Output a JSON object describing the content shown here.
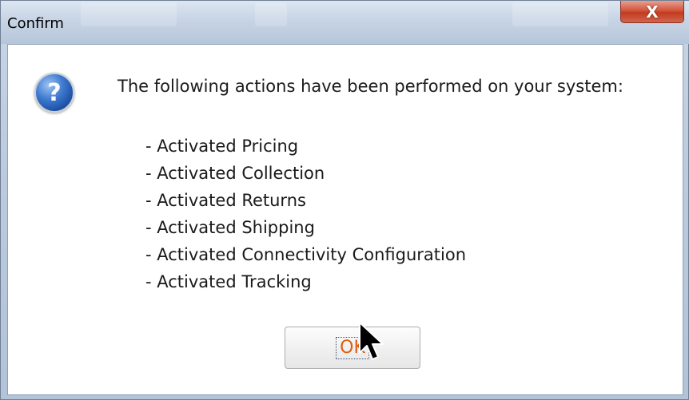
{
  "window": {
    "title": "Confirm",
    "close_glyph": "X"
  },
  "dialog": {
    "icon": "question-icon",
    "icon_glyph": "?",
    "message": "The following actions have been performed on your system:",
    "actions": [
      "- Activated Pricing",
      "- Activated Collection",
      "- Activated Returns",
      "- Activated Shipping",
      "- Activated Connectivity Configuration",
      "- Activated Tracking"
    ],
    "ok_label": "OK"
  },
  "colors": {
    "ok_text": "#e05e12",
    "close_button": "#c23b20",
    "icon_blue": "#1c4fa3"
  }
}
